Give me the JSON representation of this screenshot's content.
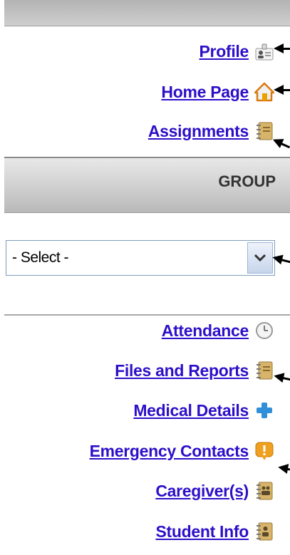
{
  "nav_top": [
    {
      "label": "Profile",
      "icon": "profile-card-icon"
    },
    {
      "label": "Home Page",
      "icon": "home-icon"
    },
    {
      "label": "Assignments",
      "icon": "notebook-icon"
    }
  ],
  "group": {
    "title": "GROUP",
    "select_value": "- Select -"
  },
  "nav_bottom": [
    {
      "label": "Attendance",
      "icon": "clock-icon"
    },
    {
      "label": "Files and Reports",
      "icon": "notebook-icon"
    },
    {
      "label": "Medical Details",
      "icon": "medical-cross-icon"
    },
    {
      "label": "Emergency Contacts",
      "icon": "alert-icon"
    },
    {
      "label": "Caregiver(s)",
      "icon": "caregivers-notebook-icon"
    },
    {
      "label": "Student Info",
      "icon": "student-notebook-icon"
    }
  ],
  "colors": {
    "link": "#2d0fc9",
    "header_gray": "#cfcfcf"
  }
}
